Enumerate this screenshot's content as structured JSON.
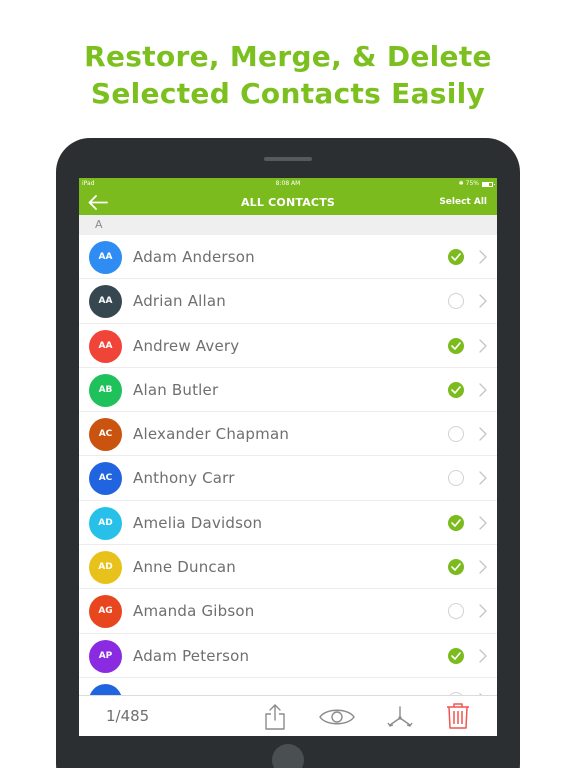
{
  "headline": {
    "line1": "Restore, Merge, & Delete",
    "line2": "Selected Contacts Easily"
  },
  "status_bar": {
    "carrier": "iPad",
    "time": "8:08 AM",
    "battery": "75%"
  },
  "nav": {
    "title": "ALL CONTACTS",
    "select_all": "Select All"
  },
  "section": "A",
  "contacts": [
    {
      "initials": "AA",
      "name": "Adam Anderson",
      "color": "#2f8cf2",
      "checked": true
    },
    {
      "initials": "AA",
      "name": "Adrian Allan",
      "color": "#37474f",
      "checked": false
    },
    {
      "initials": "AA",
      "name": "Andrew Avery",
      "color": "#f04438",
      "checked": true
    },
    {
      "initials": "AB",
      "name": "Alan Butler",
      "color": "#1fc25a",
      "checked": true
    },
    {
      "initials": "AC",
      "name": "Alexander Chapman",
      "color": "#c9530f",
      "checked": false
    },
    {
      "initials": "AC",
      "name": "Anthony Carr",
      "color": "#2164e0",
      "checked": false
    },
    {
      "initials": "AD",
      "name": "Amelia Davidson",
      "color": "#27c0e8",
      "checked": true
    },
    {
      "initials": "AD",
      "name": "Anne Duncan",
      "color": "#e8c21a",
      "checked": true
    },
    {
      "initials": "AG",
      "name": "Amanda Gibson",
      "color": "#e8461f",
      "checked": false
    },
    {
      "initials": "AP",
      "name": "Adam Peterson",
      "color": "#8a2be2",
      "checked": true
    },
    {
      "initials": "",
      "name": "",
      "color": "#2164e0",
      "checked": false
    }
  ],
  "toolbar": {
    "counter": "1/485",
    "share_icon": "share-icon",
    "view_icon": "eye-icon",
    "merge_icon": "merge-icon",
    "delete_icon": "trash-icon"
  },
  "colors": {
    "accent": "#7cbb1e",
    "headline": "#7cc01f",
    "delete": "#f0554f"
  }
}
